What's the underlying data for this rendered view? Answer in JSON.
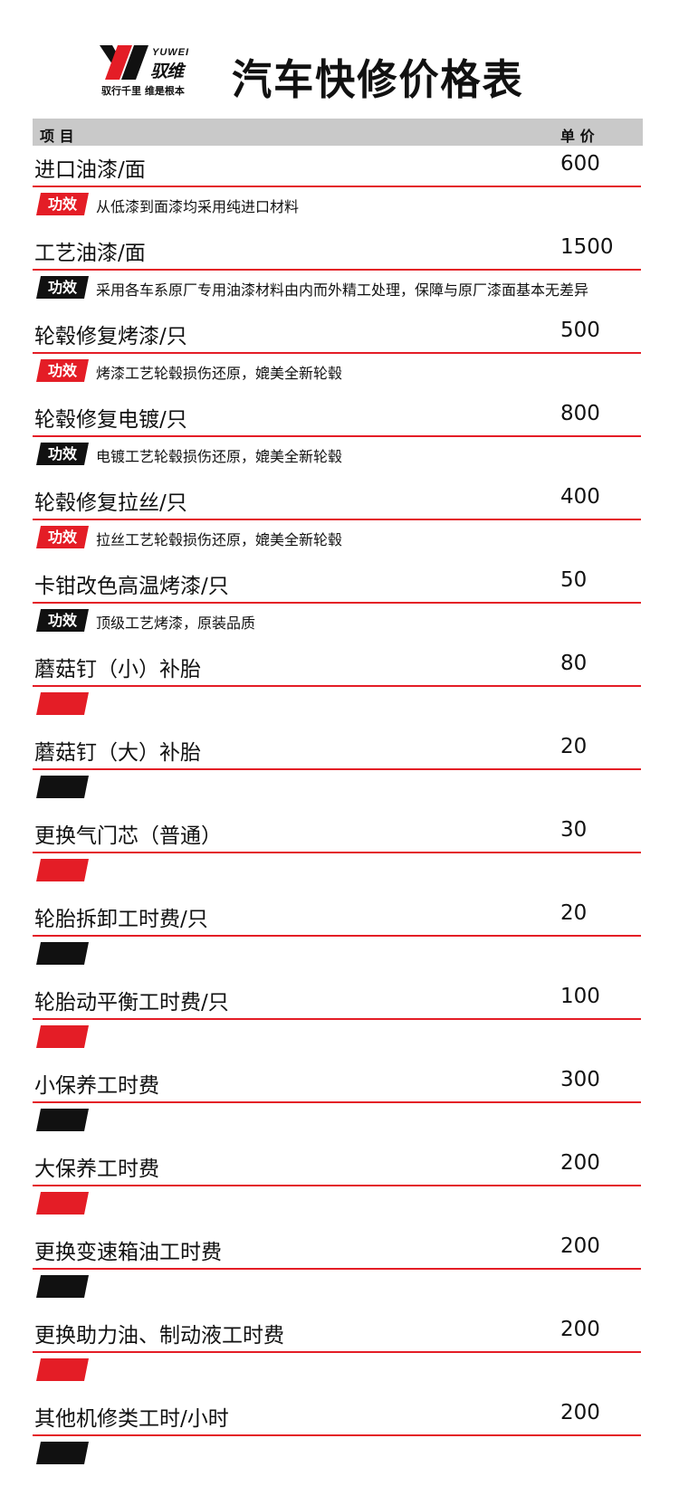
{
  "header": {
    "logo_en": "YUWEI",
    "logo_cn": "驭维",
    "logo_slogan": "驭行千里 维是根本",
    "title": "汽车快修价格表"
  },
  "columns": {
    "name": "项 目",
    "price": "单 价"
  },
  "effect_label": "功效",
  "colors": {
    "accent_red": "#e41d26",
    "black": "#111111",
    "header_gray": "#c9c9c9"
  },
  "items": [
    {
      "name": "进口油漆/面",
      "price": "600",
      "effect": "从低漆到面漆均采用纯进口材料",
      "tag_color": "red"
    },
    {
      "name": "工艺油漆/面",
      "price": "1500",
      "effect": "采用各车系原厂专用油漆材料由内而外精工处理，保障与原厂漆面基本无差异",
      "tag_color": "black"
    },
    {
      "name": "轮毂修复烤漆/只",
      "price": "500",
      "effect": "烤漆工艺轮毂损伤还原，媲美全新轮毂",
      "tag_color": "red"
    },
    {
      "name": "轮毂修复电镀/只",
      "price": "800",
      "effect": "电镀工艺轮毂损伤还原，媲美全新轮毂",
      "tag_color": "black"
    },
    {
      "name": "轮毂修复拉丝/只",
      "price": "400",
      "effect": "拉丝工艺轮毂损伤还原，媲美全新轮毂",
      "tag_color": "red"
    },
    {
      "name": "卡钳改色高温烤漆/只",
      "price": "50",
      "effect": "顶级工艺烤漆，原装品质",
      "tag_color": "black"
    },
    {
      "name": "蘑菇钉（小）补胎",
      "price": "80",
      "effect": "",
      "tag_color": "red"
    },
    {
      "name": "蘑菇钉（大）补胎",
      "price": "20",
      "effect": "",
      "tag_color": "black"
    },
    {
      "name": "更换气门芯（普通）",
      "price": "30",
      "effect": "",
      "tag_color": "red"
    },
    {
      "name": "轮胎拆卸工时费/只",
      "price": "20",
      "effect": "",
      "tag_color": "black"
    },
    {
      "name": "轮胎动平衡工时费/只",
      "price": "100",
      "effect": "",
      "tag_color": "red"
    },
    {
      "name": "小保养工时费",
      "price": "300",
      "effect": "",
      "tag_color": "black"
    },
    {
      "name": "大保养工时费",
      "price": "200",
      "effect": "",
      "tag_color": "red"
    },
    {
      "name": "更换变速箱油工时费",
      "price": "200",
      "effect": "",
      "tag_color": "black"
    },
    {
      "name": "更换助力油、制动液工时费",
      "price": "200",
      "effect": "",
      "tag_color": "red"
    },
    {
      "name": "其他机修类工时/小时",
      "price": "200",
      "effect": "",
      "tag_color": "black"
    }
  ]
}
